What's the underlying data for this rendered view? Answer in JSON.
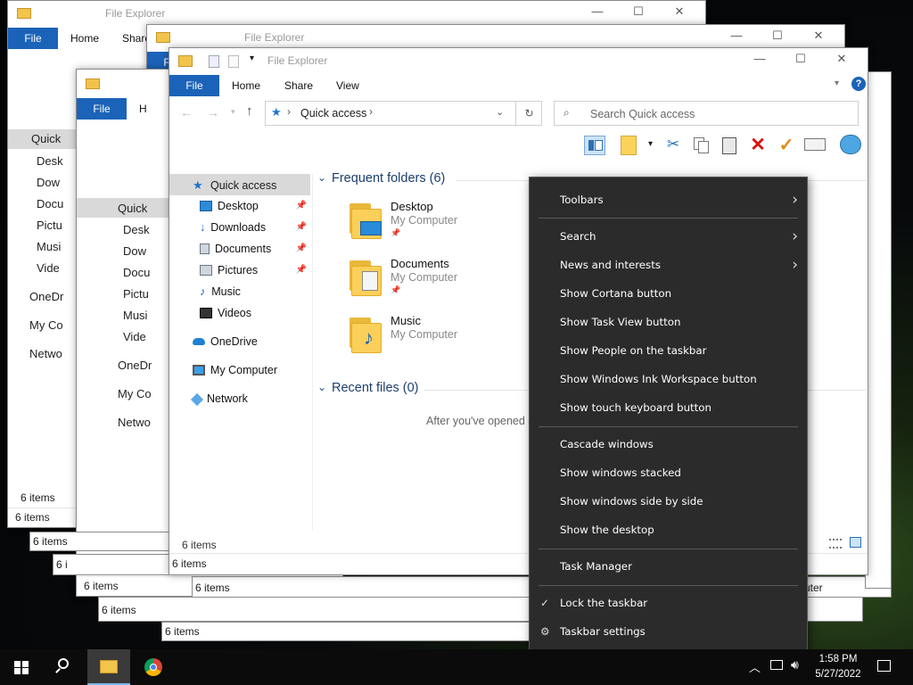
{
  "app_title": "File Explorer",
  "window_controls": {
    "minimize": "—",
    "maximize": "☐",
    "close": "✕"
  },
  "ribbon": {
    "file": "File",
    "home": "Home",
    "share": "Share",
    "view": "View",
    "help": "?"
  },
  "address": {
    "location": "Quick access",
    "search_placeholder": "Search Quick access"
  },
  "sidebar": {
    "quick_access": "Quick access",
    "items": [
      {
        "label": "Desktop",
        "pinned": true
      },
      {
        "label": "Downloads",
        "pinned": true
      },
      {
        "label": "Documents",
        "pinned": true
      },
      {
        "label": "Pictures",
        "pinned": true
      },
      {
        "label": "Music",
        "pinned": false
      },
      {
        "label": "Videos",
        "pinned": false
      }
    ],
    "onedrive": "OneDrive",
    "my_computer": "My Computer",
    "network": "Network"
  },
  "content": {
    "frequent_header": "Frequent folders (6)",
    "recent_header": "Recent files (0)",
    "recent_empty": "After you've opened s",
    "folders": [
      {
        "name": "Desktop",
        "location": "My Computer"
      },
      {
        "name": "Documents",
        "location": "My Computer"
      },
      {
        "name": "Music",
        "location": "My Computer"
      }
    ]
  },
  "status": {
    "items": "6 items"
  },
  "background_windows": {
    "nav_labels": [
      "Quick",
      "Desk",
      "Dow",
      "Docu",
      "Pictu",
      "Musi",
      "Vide",
      "OneDr",
      "My Co",
      "Netwo"
    ],
    "partial_tab": "H",
    "partial_text": "uter",
    "status_fragment": "6 i"
  },
  "context_menu": {
    "toolbars": "Toolbars",
    "search": "Search",
    "news": "News and interests",
    "cortana": "Show Cortana button",
    "task_view": "Show Task View button",
    "people": "Show People on the taskbar",
    "ink": "Show Windows Ink Workspace button",
    "touch_keyboard": "Show touch keyboard button",
    "cascade": "Cascade windows",
    "stacked": "Show windows stacked",
    "side_by_side": "Show windows side by side",
    "desktop": "Show the desktop",
    "task_manager": "Task Manager",
    "lock": "Lock the taskbar",
    "settings": "Taskbar settings"
  },
  "taskbar": {
    "time": "1:58 PM",
    "date": "5/27/2022"
  },
  "colors": {
    "accent": "#1b63b8",
    "menu_bg": "#2b2b2b",
    "taskbar_bg": "#0b0b0b"
  }
}
